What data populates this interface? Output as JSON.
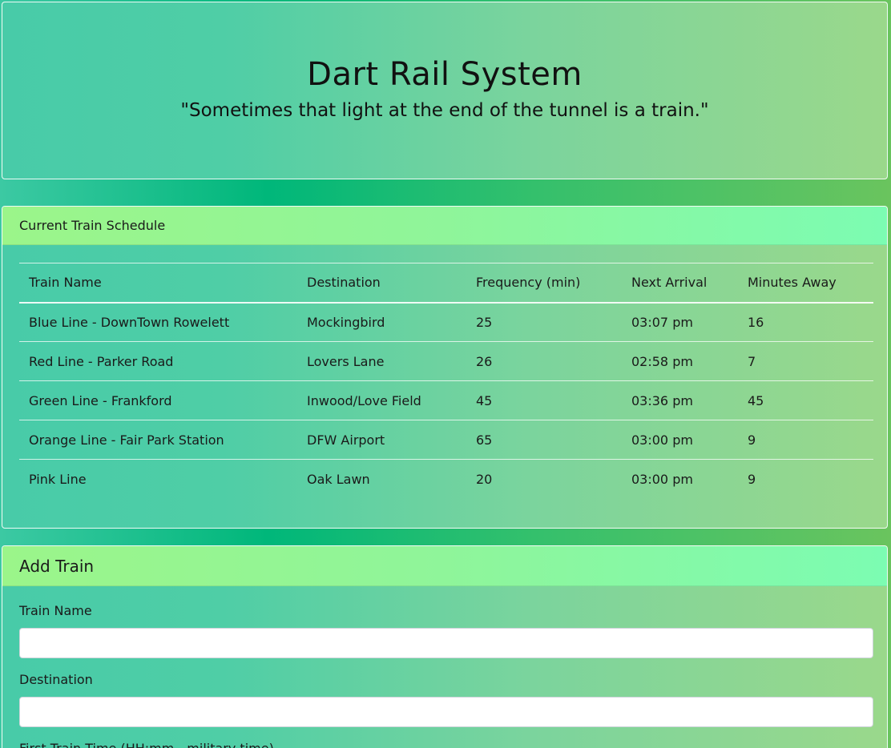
{
  "header": {
    "title": "Dart Rail System",
    "tagline": "\"Sometimes that light at the end of the tunnel is a train.\""
  },
  "schedule": {
    "heading": "Current Train Schedule",
    "columns": [
      "Train Name",
      "Destination",
      "Frequency (min)",
      "Next Arrival",
      "Minutes Away"
    ],
    "rows": [
      [
        "Blue Line - DownTown Rowelett",
        "Mockingbird",
        "25",
        "03:07 pm",
        "16"
      ],
      [
        "Red Line - Parker Road",
        "Lovers Lane",
        "26",
        "02:58 pm",
        "7"
      ],
      [
        "Green Line - Frankford",
        "Inwood/Love Field",
        "45",
        "03:36 pm",
        "45"
      ],
      [
        "Orange Line - Fair Park Station",
        "DFW Airport",
        "65",
        "03:00 pm",
        "9"
      ],
      [
        "Pink Line",
        "Oak Lawn",
        "20",
        "03:00 pm",
        "9"
      ]
    ]
  },
  "add_train": {
    "heading": "Add Train",
    "fields": [
      {
        "label": "Train Name",
        "value": ""
      },
      {
        "label": "Destination",
        "value": ""
      },
      {
        "label": "First Train Time (HH:mm - military time)",
        "value": ""
      }
    ]
  },
  "colors": {
    "header_accent": "#9bf58a",
    "header_accent_end": "#7cfcb2",
    "background": "#00b77a"
  }
}
